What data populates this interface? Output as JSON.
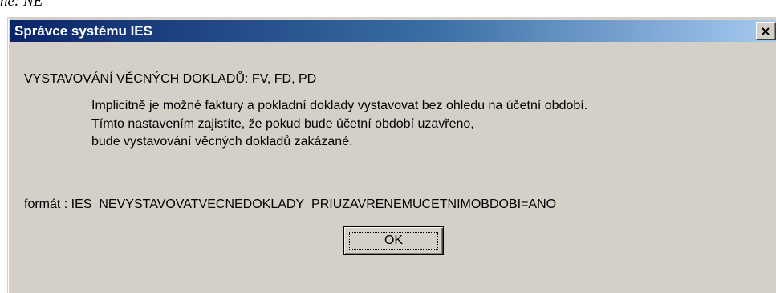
{
  "background": {
    "fragment_text": "ne: NE"
  },
  "dialog": {
    "title": "Správce systému IES",
    "close_icon": "close-x-icon",
    "heading": "VYSTAVOVÁNÍ VĚCNÝCH DOKLADŮ: FV, FD, PD",
    "description_lines": [
      "Implicitně je možné faktury a pokladní doklady vystavovat bez ohledu na účetní období.",
      "Tímto nastavením zajistíte, že pokud bude účetní období uzavřeno,",
      "bude vystavování věcných dokladů zakázané."
    ],
    "format_line": "formát : IES_NEVYSTAVOVATVECNEDOKLADY_PRIUZAVRENEMUCETNIMOBDOBI=ANO",
    "ok_label": "OK"
  },
  "colors": {
    "titlebar_start": "#0a246a",
    "titlebar_end": "#a6caf0",
    "dialog_face": "#d4d0c8"
  }
}
